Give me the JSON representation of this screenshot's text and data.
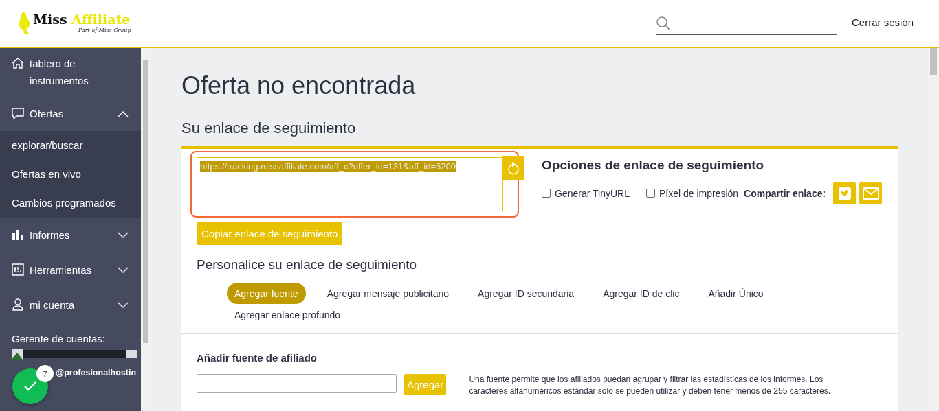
{
  "header": {
    "logo_text": "Miss",
    "logo_accent": "Affiliate",
    "logo_tagline": "Part of Miss Group",
    "logout": "Cerrar sesión"
  },
  "sidebar": {
    "items": [
      {
        "label": "tablero de instrumentos"
      },
      {
        "label": "Ofertas",
        "expanded": true,
        "children": [
          {
            "label": "explorar/buscar"
          },
          {
            "label": "Ofertas en vivo"
          },
          {
            "label": "Cambios programados"
          }
        ]
      },
      {
        "label": "Informes",
        "expanded": false
      },
      {
        "label": "Herramientas",
        "expanded": false
      },
      {
        "label": "mi cuenta",
        "expanded": false
      }
    ],
    "manager_label": "Gerente de cuentas:",
    "manager_email": "@profesionalhostin"
  },
  "notification": {
    "count": "7"
  },
  "page": {
    "title": "Oferta no encontrada",
    "subtitle": "Su enlace de seguimiento",
    "tracking_link": {
      "value": "https://tracking.missaffiliate.com/aff_c?offer_id=131&aff_id=5200",
      "text_selected": true,
      "highlighted": true
    },
    "copy_button": "Copiar enlace de seguimiento",
    "options": {
      "title": "Opciones de enlace de seguimiento",
      "checkboxes": [
        {
          "label": "Generar TinyURL",
          "checked": false
        },
        {
          "label": "Píxel de impresión",
          "checked": false
        }
      ],
      "share_label": "Compartir enlace:",
      "share_buttons": [
        {
          "kind": "twitter"
        },
        {
          "kind": "email"
        }
      ]
    },
    "customize": {
      "title": "Personalice su enlace de seguimiento",
      "tabs": [
        {
          "label": "Agregar fuente",
          "selected": true
        },
        {
          "label": "Agregar mensaje publicitario",
          "selected": false
        },
        {
          "label": "Agregar ID secundaria",
          "selected": false
        },
        {
          "label": "Agregar ID de clic",
          "selected": false
        },
        {
          "label": "Añadir Único",
          "selected": false
        },
        {
          "label": "Agregar enlace profundo",
          "selected": false
        }
      ]
    },
    "source": {
      "title": "Añadir fuente de afiliado",
      "button": "Agregar",
      "help": "Una fuente permite que los afiliados puedan agrupar y filtrar las estadísticas de los informes. Los caracteres alfanuméricos estándar solo se pueden utilizar y deben tener menos de 255 caracteres."
    }
  }
}
